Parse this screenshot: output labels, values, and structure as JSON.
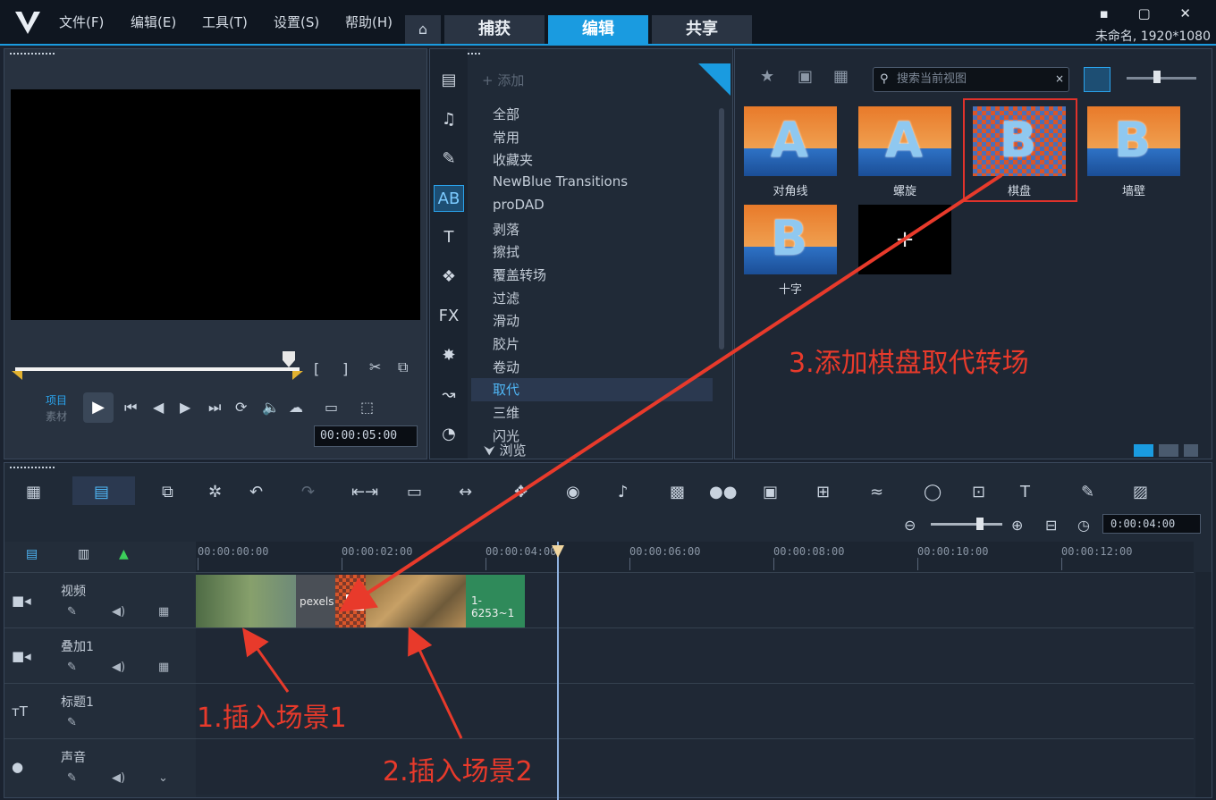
{
  "titlebar": {
    "menus": [
      "文件(F)",
      "编辑(E)",
      "工具(T)",
      "设置(S)",
      "帮助(H)"
    ],
    "tabs": [
      "捕获",
      "编辑",
      "共享"
    ],
    "active_tab": "编辑",
    "project_info": "未命名, 1920*1080",
    "window_controls": "▪ ▢ ✕"
  },
  "preview": {
    "mode_project": "项目",
    "mode_clip": "素材",
    "timecode": "00:00:05:00",
    "buttons": [
      "[",
      "]"
    ]
  },
  "library": {
    "add_label": "添加",
    "categories": [
      "全部",
      "常用",
      "收藏夹",
      "NewBlue Transitions",
      "proDAD",
      "剥落",
      "擦拭",
      "覆盖转场",
      "过滤",
      "滑动",
      "胶片",
      "卷动",
      "取代",
      "三维",
      "闪光"
    ],
    "selected_category": "取代",
    "browse_label": "浏览"
  },
  "transitions": {
    "search_placeholder": "搜索当前视图",
    "items": [
      {
        "label": "对角线",
        "glyph": "A"
      },
      {
        "label": "螺旋",
        "glyph": "A"
      },
      {
        "label": "棋盘",
        "glyph": "B"
      },
      {
        "label": "墙壁",
        "glyph": "B"
      },
      {
        "label": "十字",
        "glyph": "B"
      }
    ],
    "selected": "棋盘",
    "annotation": "3.添加棋盘取代转场"
  },
  "timeline": {
    "timecode": "0:00:04:00",
    "ruler_labels": [
      "00:00:00:00",
      "00:00:02:00",
      "00:00:04:00",
      "00:00:06:00",
      "00:00:08:00",
      "00:00:10:00",
      "00:00:12:00"
    ],
    "tracks": [
      "视频",
      "叠加1",
      "标题1",
      "声音"
    ],
    "clips": {
      "pexels_label": "pexels",
      "audio_label": "1-6253~1"
    },
    "annotation1": "1.插入场景1",
    "annotation2": "2.插入场景2"
  },
  "colors": {
    "accent": "#1a9be0",
    "annotation": "#e83a2b",
    "background": "#1b2330"
  }
}
